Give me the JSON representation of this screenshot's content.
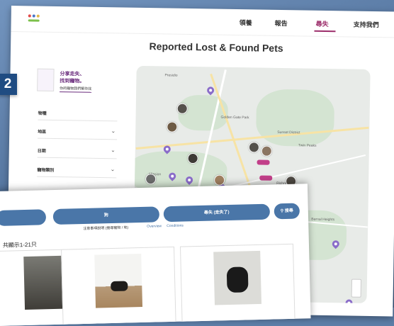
{
  "nav": {
    "items": [
      "領養",
      "報告",
      "尋失",
      "支持我們"
    ],
    "active_index": 2
  },
  "page": {
    "title": "Reported Lost & Found Pets"
  },
  "promo": {
    "line1": "分享走失、",
    "line2": "找到寵物。",
    "line3": "你的寵物我們幫你找"
  },
  "filters": [
    {
      "label": "物種",
      "has_dropdown": false
    },
    {
      "label": "地區",
      "has_dropdown": true
    },
    {
      "label": "日期",
      "has_dropdown": true
    },
    {
      "label": "寵物類別",
      "has_dropdown": true
    }
  ],
  "map": {
    "labels": [
      "Golden Gate Park",
      "Sunset District",
      "Twin Peaks",
      "Presidio",
      "Mission",
      "Bernal Heights",
      "Richmond"
    ]
  },
  "step_badge": "2",
  "front": {
    "buttons": [
      "",
      "狗",
      "尋失 (走失了)",
      "搜尋"
    ],
    "subtext": "注意事項說明 (搜尋寵物 / 地)",
    "links": [
      "Overview",
      "Conditions"
    ],
    "result_count": "共顯示1-21只"
  },
  "colors": {
    "accent": "#9c2e6b",
    "pill": "#4a76a8",
    "pin": "#8a6cc9",
    "badge": "#1f4c82"
  }
}
